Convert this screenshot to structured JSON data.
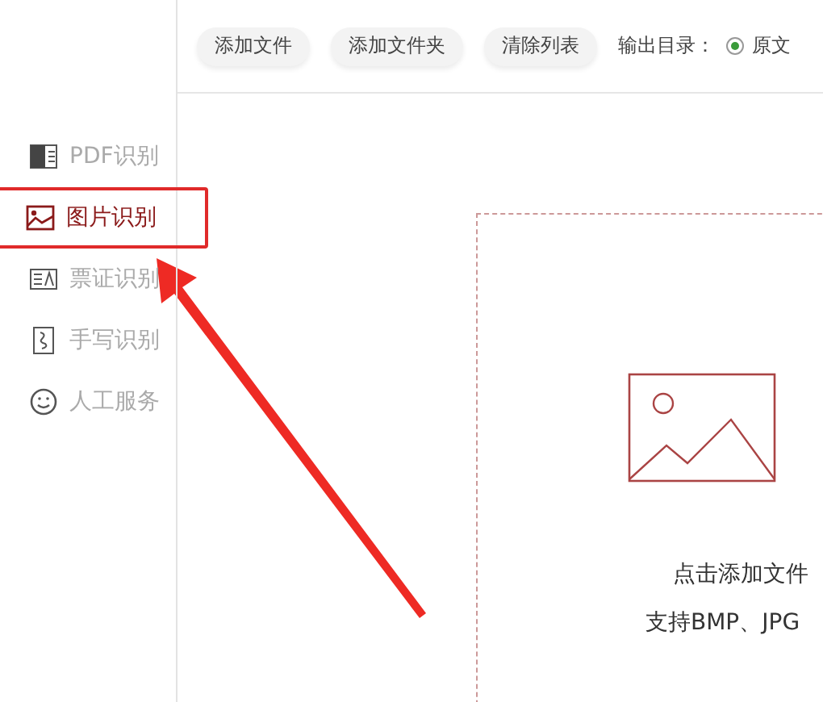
{
  "toolbar": {
    "buttons": [
      "添加文件",
      "添加文件夹",
      "清除列表"
    ],
    "output_label": "输出目录：",
    "output_option": {
      "label": "原文",
      "checked": true
    }
  },
  "sidebar": {
    "items": [
      {
        "label": "PDF识别",
        "kind": "pdf",
        "selected": false,
        "highlighted": false
      },
      {
        "label": "图片识别",
        "kind": "image",
        "selected": true,
        "highlighted": true
      },
      {
        "label": "票证识别",
        "kind": "ticket",
        "selected": false,
        "highlighted": false
      },
      {
        "label": "手写识别",
        "kind": "handwriting",
        "selected": false,
        "highlighted": false
      },
      {
        "label": "人工服务",
        "kind": "service",
        "selected": false,
        "highlighted": false
      }
    ]
  },
  "drop_zone": {
    "lines": [
      "点击添加文件",
      "支持BMP、JPG"
    ]
  }
}
